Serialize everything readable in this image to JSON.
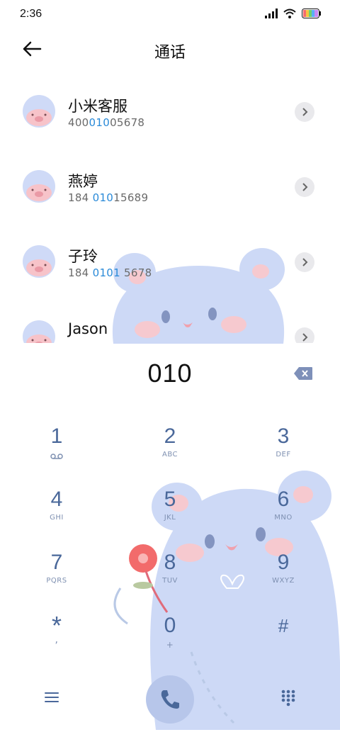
{
  "status_bar": {
    "time": "2:36"
  },
  "header": {
    "title": "通话"
  },
  "contacts": [
    {
      "name": "小米客服",
      "number_parts": [
        "400",
        "010",
        "05678"
      ]
    },
    {
      "name": "燕婷",
      "number_parts": [
        "184 ",
        "010",
        "15689"
      ]
    },
    {
      "name": "子玲",
      "number_parts": [
        "184 ",
        "0101",
        " 5678"
      ]
    },
    {
      "name": "Jason",
      "number_parts": [
        "",
        "",
        ""
      ]
    }
  ],
  "dialer": {
    "input": "010"
  },
  "keypad": [
    {
      "digit": "1",
      "letters": ""
    },
    {
      "digit": "2",
      "letters": "ABC"
    },
    {
      "digit": "3",
      "letters": "DEF"
    },
    {
      "digit": "4",
      "letters": "GHI"
    },
    {
      "digit": "5",
      "letters": "JKL"
    },
    {
      "digit": "6",
      "letters": "MNO"
    },
    {
      "digit": "7",
      "letters": "PQRS"
    },
    {
      "digit": "8",
      "letters": "TUV"
    },
    {
      "digit": "9",
      "letters": "WXYZ"
    },
    {
      "digit": "*",
      "letters": ","
    },
    {
      "digit": "0",
      "letters": "+"
    },
    {
      "digit": "#",
      "letters": ""
    }
  ],
  "colors": {
    "accent": "#4a689a",
    "highlight": "#2a8ad8",
    "bear": "#cdd9f6",
    "call_button": "#b7c6ea"
  }
}
